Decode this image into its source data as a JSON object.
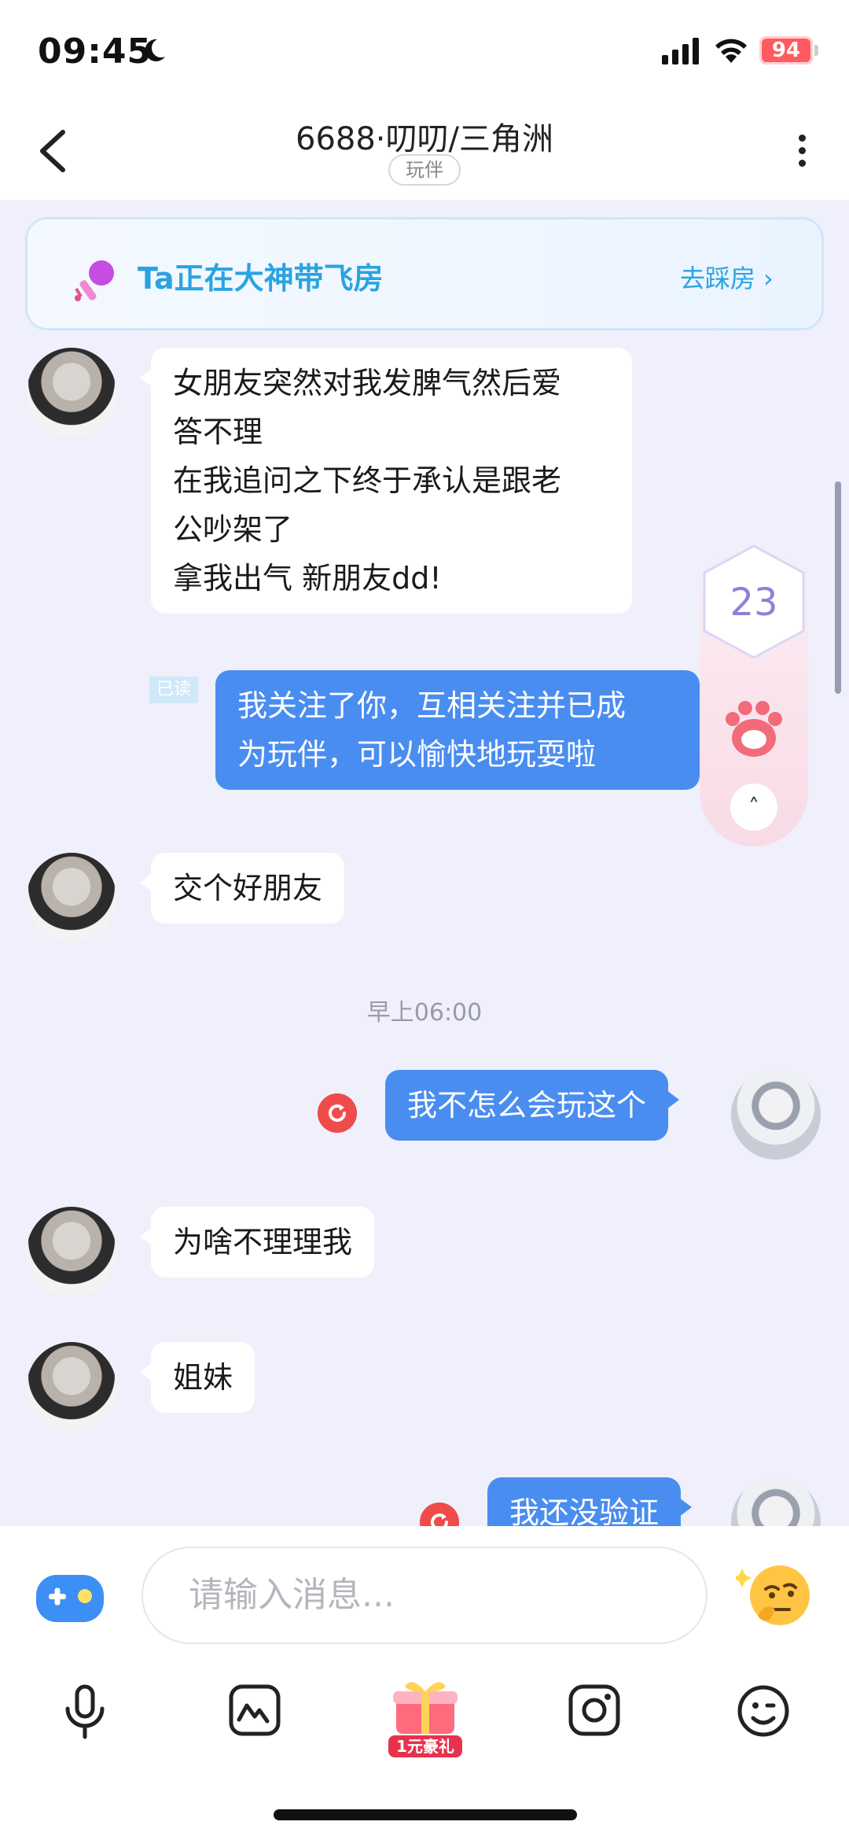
{
  "status_bar": {
    "time": "09:45",
    "battery": "94"
  },
  "header": {
    "title": "6688·叨叨/三角洲",
    "tag": "玩伴"
  },
  "banner": {
    "text": "Ta正在大神带飞房",
    "link": "去踩房"
  },
  "messages": [
    {
      "side": "left",
      "text": "女朋友突然对我发脾气然后爱\n答不理\n在我追问之下终于承认是跟老\n公吵架了\n拿我出气 新朋友dd!"
    },
    {
      "side": "right",
      "read": "已读",
      "text": "我关注了你，互相关注并已成\n为玩伴，可以愉快地玩耍啦"
    },
    {
      "side": "left",
      "text": "交个好朋友"
    },
    {
      "side": "right",
      "text": "我不怎么会玩这个"
    },
    {
      "side": "left",
      "text": "为啥不理理我"
    },
    {
      "side": "left",
      "text": "姐妹"
    },
    {
      "side": "right",
      "text": "我还没验证"
    }
  ],
  "timestamp": "早上06:00",
  "float_panel": {
    "count": "23"
  },
  "input": {
    "placeholder": "请输入消息..."
  },
  "toolbar": {
    "gift_label": "1元豪礼"
  },
  "colors": {
    "accent": "#4a8df0",
    "banner_text": "#2aa3e0",
    "background": "#eff0fb"
  }
}
